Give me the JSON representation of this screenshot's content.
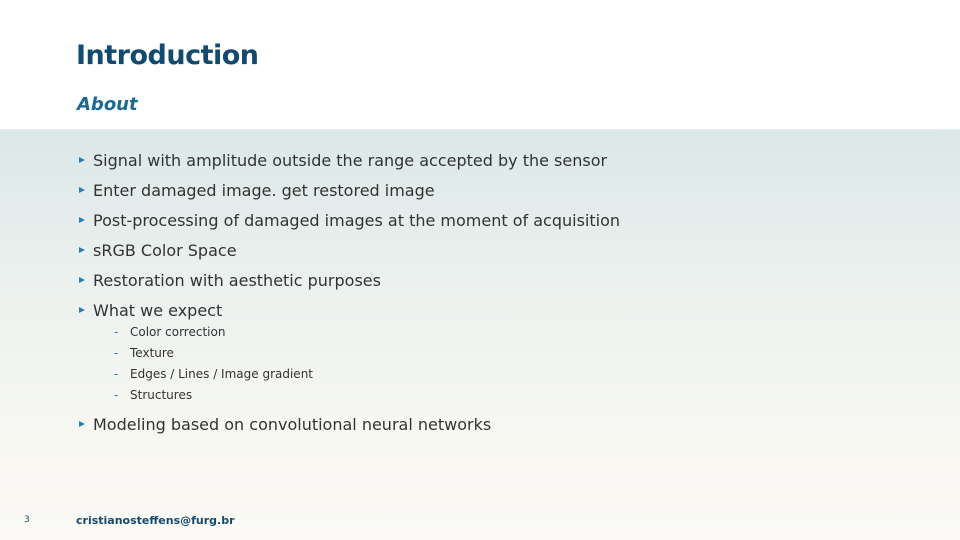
{
  "slide": {
    "title": "Introduction",
    "subtitle": "About",
    "bullets": [
      {
        "text": "Signal with amplitude outside the range accepted by the sensor"
      },
      {
        "text": "Enter damaged image. get restored image"
      },
      {
        "text": "Post-processing of damaged images at the moment of acquisition"
      },
      {
        "text": "sRGB Color Space"
      },
      {
        "text": "Restoration with aesthetic purposes"
      },
      {
        "text": "What we expect"
      },
      {
        "text": "Modeling based on convolutional neural networks"
      }
    ],
    "sub_bullets": [
      {
        "text": "Color correction"
      },
      {
        "text": "Texture"
      },
      {
        "text": "Edges / Lines / Image gradient"
      },
      {
        "text": "Structures"
      }
    ],
    "sub_marker": "-",
    "footer": {
      "page_number": "3",
      "email": "cristianosteffens@furg.br"
    }
  },
  "colors": {
    "title": "#134a70",
    "subtitle": "#1b6a96",
    "bullet_marker": "#2a7fb0",
    "body_text": "#333333"
  },
  "icons": {
    "bullet_marker": "triangle-right-icon"
  }
}
